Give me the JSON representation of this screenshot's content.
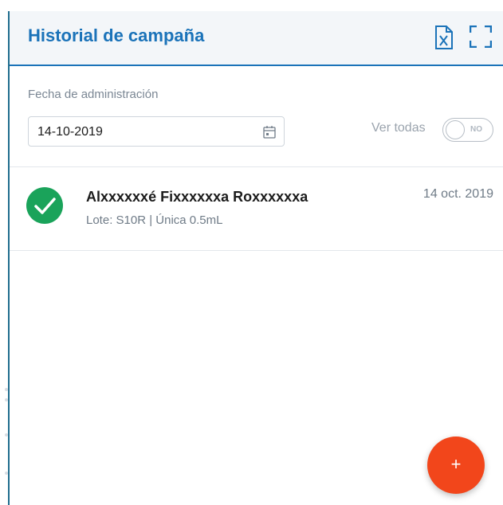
{
  "panel": {
    "title": "Historial de campaña",
    "icons": [
      "excel-export-icon",
      "fullscreen-icon"
    ],
    "accent_color": "#1b73b9"
  },
  "filter": {
    "date_label": "Fecha de administración",
    "date_value": "14-10-2019",
    "show_all_label": "Ver todas",
    "toggle_state_label": "NO"
  },
  "records": [
    {
      "name": "Alxxxxxxé Fixxxxxxa Roxxxxxxa",
      "detail": "Lote: S10R | Única 0.5mL",
      "date": "14 oct. 2019",
      "status": "completed",
      "status_color": "#1aa35a"
    }
  ],
  "fab": {
    "label": "+",
    "color": "#f2461b"
  }
}
